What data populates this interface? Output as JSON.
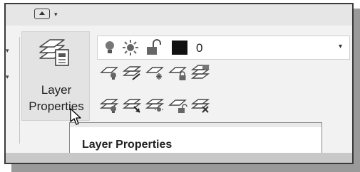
{
  "quick_access": {
    "customize_icon": "ribbon-toggle-icon",
    "dropdown_arrow": "▾"
  },
  "ribbon_panel": {
    "left_arrows": [
      "▾",
      "▾"
    ],
    "layer_properties_button": {
      "label_line1": "Layer",
      "label_line2": "Properties",
      "icon": "layer-properties-icon"
    },
    "layer_dropdown": {
      "current_layer": "0",
      "dropdown_arrow": "▾",
      "icons": [
        "lightbulb-on-icon",
        "sun-thaw-icon",
        "unlock-icon",
        "color-swatch-icon"
      ],
      "color_swatch": "#111111"
    },
    "tool_row_1": [
      "layer-off-icon",
      "make-current-icon",
      "layer-freeze-icon",
      "layer-lock-icon",
      "match-layer-icon"
    ],
    "tool_row_2": [
      "layer-on-icon",
      "change-to-current-icon",
      "layer-thaw-icon",
      "layer-unlock-icon",
      "layer-isolate-icon"
    ]
  },
  "tooltip": {
    "title": "Layer Properties"
  },
  "colors": {
    "ribbon_bg": "#f2f2f2",
    "button_hover": "#e3e3e3",
    "frame_border": "#3a3a3a",
    "shadow": "#9a9a9a"
  }
}
